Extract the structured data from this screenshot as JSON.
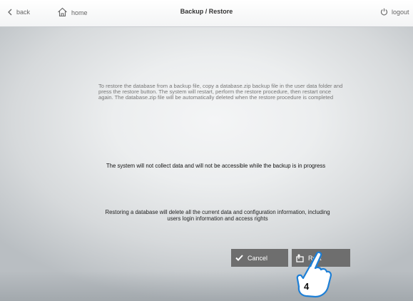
{
  "header": {
    "back_label": "back",
    "home_label": "home",
    "title": "Backup / Restore",
    "logout_label": "logout"
  },
  "messages": {
    "restore_instructions": "To restore the database from a backup file, copy a database.zip backup file in the user data folder and press the restore button. The system will restart, perform the restore procedure, then restart once again. The database.zip file will be automatically deleted when the restore procedure is completed",
    "backup_warning": "The system will not collect data and will not be accessible while the backup is in progress",
    "restore_warning": "Restoring a database will delete all the current data and configuration information, including users login information and access rights"
  },
  "actions": {
    "cancel_label": "Cancel",
    "restore_label": "Rest"
  },
  "overlay": {
    "step_number": "4"
  }
}
